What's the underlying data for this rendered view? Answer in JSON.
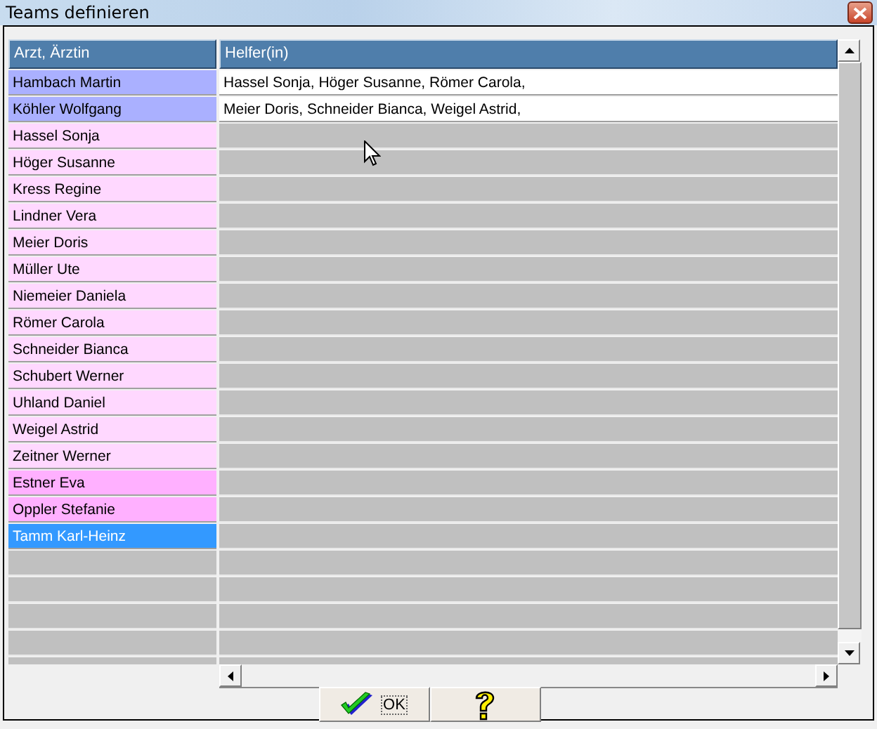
{
  "window": {
    "title": "Teams definieren"
  },
  "table": {
    "columns": [
      "Arzt, Ärztin",
      "Helfer(in)"
    ],
    "rows": [
      {
        "name": "Hambach Martin",
        "helpers": "Hassel Sonja, Höger Susanne, Römer Carola,",
        "color": "#aab0ff",
        "selected": false
      },
      {
        "name": "Köhler Wolfgang",
        "helpers": "Meier Doris, Schneider Bianca, Weigel Astrid,",
        "color": "#aab0ff",
        "selected": false
      },
      {
        "name": "Hassel Sonja",
        "color": "#ffd8ff",
        "selected": false
      },
      {
        "name": "Höger Susanne",
        "color": "#ffd8ff",
        "selected": false
      },
      {
        "name": "Kress Regine",
        "color": "#ffd8ff",
        "selected": false
      },
      {
        "name": "Lindner Vera",
        "color": "#ffd8ff",
        "selected": false
      },
      {
        "name": "Meier Doris",
        "color": "#ffd8ff",
        "selected": false
      },
      {
        "name": "Müller Ute",
        "color": "#ffd8ff",
        "selected": false
      },
      {
        "name": "Niemeier Daniela",
        "color": "#ffd8ff",
        "selected": false
      },
      {
        "name": "Römer Carola",
        "color": "#ffd8ff",
        "selected": false
      },
      {
        "name": "Schneider Bianca",
        "color": "#ffd8ff",
        "selected": false
      },
      {
        "name": "Schubert Werner",
        "color": "#ffd8ff",
        "selected": false
      },
      {
        "name": "Uhland Daniel",
        "color": "#ffd8ff",
        "selected": false
      },
      {
        "name": "Weigel Astrid",
        "color": "#ffd8ff",
        "selected": false
      },
      {
        "name": "Zeitner Werner",
        "color": "#ffd8ff",
        "selected": false
      },
      {
        "name": "Estner Eva",
        "color": "#ffb0ff",
        "selected": false
      },
      {
        "name": "Oppler Stefanie",
        "color": "#ffb0ff",
        "selected": false
      },
      {
        "name": "Tamm Karl-Heinz",
        "selected": true
      }
    ]
  },
  "buttons": [
    {
      "kind": "ok",
      "label": "OK"
    },
    {
      "kind": "help"
    }
  ]
}
